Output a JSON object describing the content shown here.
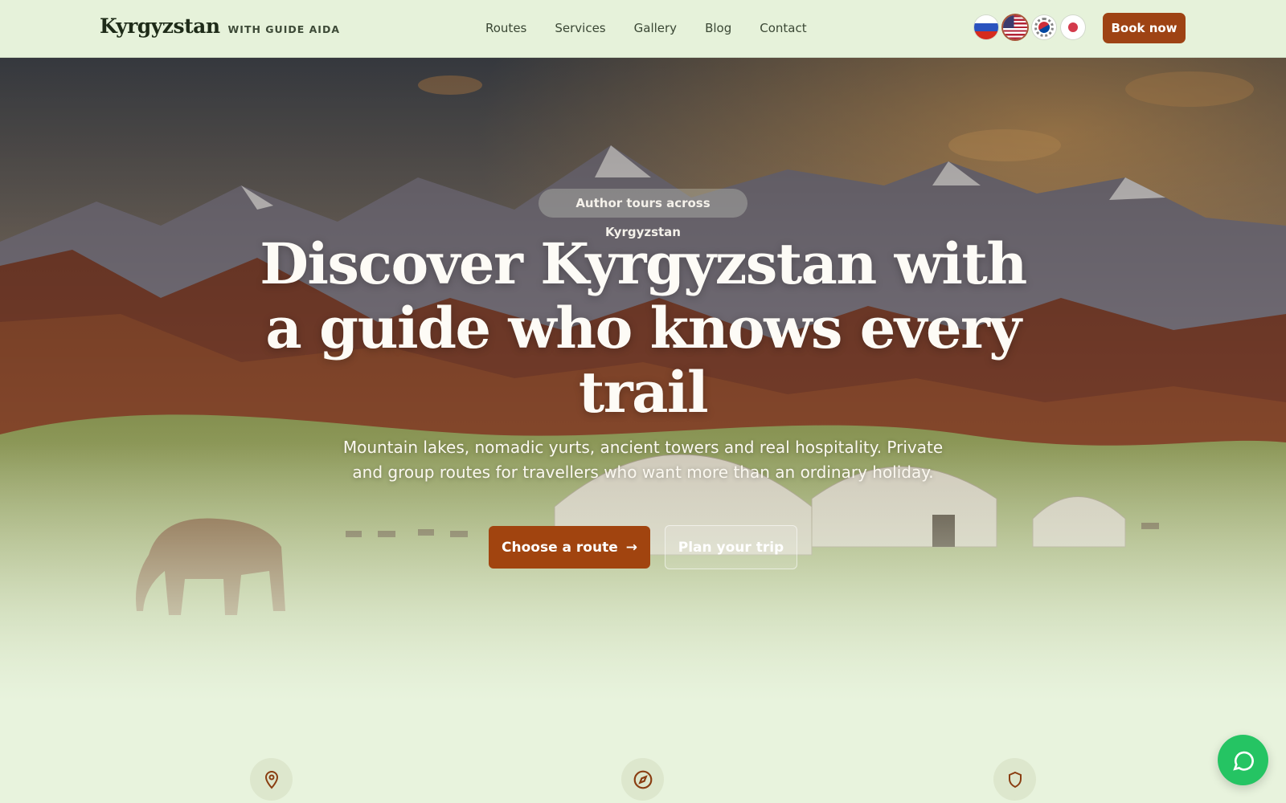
{
  "header": {
    "brand_name": "Kyrgyzstan",
    "brand_tag": "WITH GUIDE AIDA",
    "nav": [
      "Routes",
      "Services",
      "Gallery",
      "Blog",
      "Contact"
    ],
    "languages": [
      {
        "code": "ru",
        "icon": "russia-flag-icon",
        "active": false
      },
      {
        "code": "en",
        "icon": "usa-flag-icon",
        "active": true
      },
      {
        "code": "ko",
        "icon": "south-korea-flag-icon",
        "active": false
      },
      {
        "code": "ja",
        "icon": "japan-flag-icon",
        "active": false
      }
    ],
    "book_label": "Book now"
  },
  "hero": {
    "badge": "Author tours across Kyrgyzstan",
    "title": "Discover Kyrgyzstan with a guide who knows every trail",
    "subtitle": "Mountain lakes, nomadic yurts, ancient towers and real hospitality. Private and group routes for travellers who want more than an ordinary holiday.",
    "primary_cta": "Choose a route",
    "primary_cta_icon": "arrow-right-icon",
    "secondary_cta": "Plan your trip"
  },
  "features": {
    "icons": [
      "map-pin-icon",
      "compass-icon",
      "shield-icon"
    ]
  },
  "chat": {
    "icon": "chat-bubble-icon"
  },
  "colors": {
    "accent": "#9e4314",
    "header_bg": "#e6f2da",
    "page_bg": "#e8f3dd",
    "chat": "#25c463"
  }
}
